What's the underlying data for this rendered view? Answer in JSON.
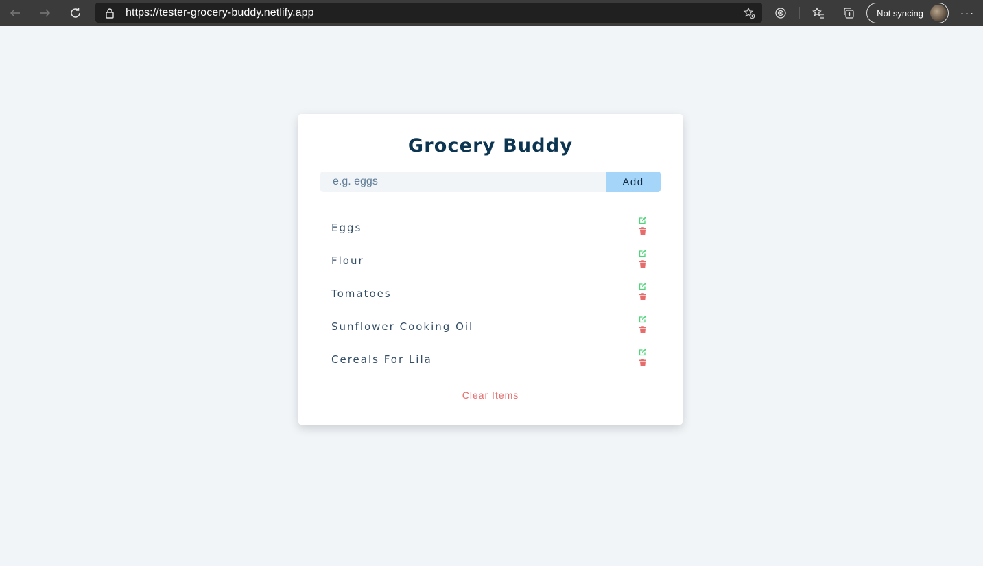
{
  "browser": {
    "url": "https://tester-grocery-buddy.netlify.app",
    "sync_label": "Not syncing",
    "more_label": "···"
  },
  "app": {
    "title": "Grocery Buddy",
    "input_placeholder": "e.g. eggs",
    "add_label": "Add",
    "clear_label": "Clear Items",
    "items": [
      {
        "title": "Eggs"
      },
      {
        "title": "Flour"
      },
      {
        "title": "Tomatoes"
      },
      {
        "title": "Sunflower Cooking Oil"
      },
      {
        "title": "Cereals For Lila"
      }
    ]
  },
  "colors": {
    "edit": "#4fd47a",
    "delete": "#e66b6b",
    "title": "#0c3551",
    "add_button": "#a5d5f8",
    "background": "#f1f5f8"
  },
  "icons": {
    "edit": "edit-icon",
    "delete": "trash-icon"
  }
}
